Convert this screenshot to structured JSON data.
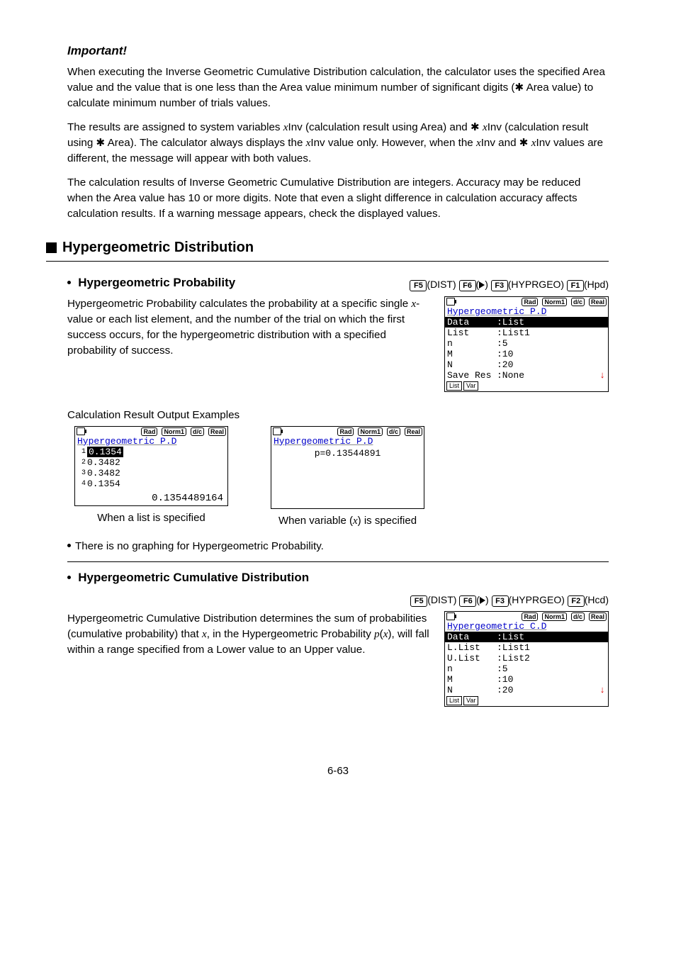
{
  "important_heading": "Important!",
  "para1a": "When executing the Inverse Geometric Cumulative Distribution calculation, the calculator uses the specified Area value and the value that is one less than the Area value minimum number of significant digits (",
  "para1b": " Area value) to calculate minimum number of trials values.",
  "para2a": "The results are assigned to system variables ",
  "para2b": "Inv (calculation result using Area) and ",
  "para2c": "Inv (calculation result using ",
  "para2d": " Area). The calculator always displays the ",
  "para2e": "Inv value only. However, when the ",
  "para2f": "Inv and ",
  "para2g": "Inv values are different, the message will appear with both values.",
  "para3": "The calculation results of Inverse Geometric Cumulative Distribution are integers. Accuracy may be reduced when the Area value has 10 or more digits. Note that even a slight difference in calculation accuracy affects calculation results. If a warning message appears, check the displayed values.",
  "section_heading": "Hypergeometric Distribution",
  "sub1_heading": "Hypergeometric Probability",
  "sub1_desc": "Hypergeometric Probability calculates the probability at a specific single ",
  "sub1_desc2": "-value or each list element, and the number of the trial on which the first success occurs, for the hypergeometric distribution with a specified probability of success.",
  "keys": {
    "f5": "F5",
    "dist": "(DIST)",
    "f6": "F6",
    "triangle": "(▷)",
    "f3": "F3",
    "hyprgeo": "(HYPRGEO)",
    "f1": "F1",
    "hpd": "(Hpd)",
    "f2": "F2",
    "hcd": "(Hcd)"
  },
  "screen1": {
    "status": [
      "Rad",
      "Norm1",
      "d/c",
      "Real"
    ],
    "title": "Hypergeometric P.D",
    "rows": [
      {
        "label": "Data",
        "value": ":List",
        "hl": true
      },
      {
        "label": "List",
        "value": ":List1"
      },
      {
        "label": "n",
        "value": ":5"
      },
      {
        "label": "M",
        "value": ":10"
      },
      {
        "label": "N",
        "value": ":20"
      },
      {
        "label": "Save Res",
        "value": ":None"
      }
    ],
    "tabs": [
      "List",
      "Var"
    ]
  },
  "outex_heading": "Calculation Result Output Examples",
  "screen2": {
    "status": [
      "Rad",
      "Norm1",
      "d/c",
      "Real"
    ],
    "title": "Hypergeometric P.D",
    "list": [
      {
        "idx": "1",
        "val": "0.1354",
        "hl": true
      },
      {
        "idx": "2",
        "val": "0.3482"
      },
      {
        "idx": "3",
        "val": "0.3482"
      },
      {
        "idx": "4",
        "val": "0.1354"
      }
    ],
    "bigval": "0.1354489164"
  },
  "screen3": {
    "status": [
      "Rad",
      "Norm1",
      "d/c",
      "Real"
    ],
    "title": "Hypergeometric P.D",
    "line": "p=0.13544891"
  },
  "capt1": "When a list is specified",
  "capt2a": "When variable (",
  "capt2b": ") is specified",
  "bullet1": "There is no graphing for Hypergeometric Probability.",
  "sub2_heading": "Hypergeometric Cumulative Distribution",
  "sub2_desc1": "Hypergeometric Cumulative Distribution determines the sum of probabilities (cumulative probability) that ",
  "sub2_desc2": ", in the Hypergeometric Probability ",
  "sub2_desc3": ", will fall within a range specified from a Lower value to an Upper value.",
  "px_p": "p",
  "px_x": "x",
  "screen4": {
    "status": [
      "Rad",
      "Norm1",
      "d/c",
      "Real"
    ],
    "title": "Hypergeometric C.D",
    "rows": [
      {
        "label": "Data",
        "value": ":List",
        "hl": true
      },
      {
        "label": "L.List",
        "value": ":List1"
      },
      {
        "label": "U.List",
        "value": ":List2"
      },
      {
        "label": "n",
        "value": ":5"
      },
      {
        "label": "M",
        "value": ":10"
      },
      {
        "label": "N",
        "value": ":20"
      }
    ],
    "tabs": [
      "List",
      "Var"
    ]
  },
  "ast": "✱",
  "x": "x",
  "pagenum": "6-63"
}
